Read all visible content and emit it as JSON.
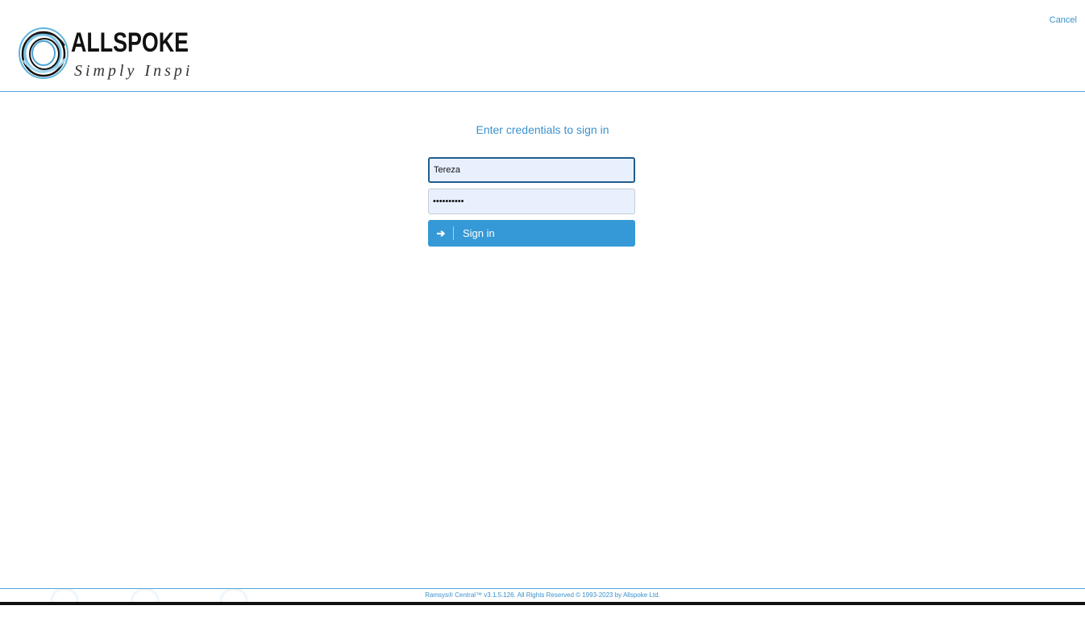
{
  "header": {
    "logo": {
      "brand": "ALLSPOKE",
      "tagline": "Simply Inspired"
    },
    "cancel_label": "Cancel"
  },
  "form": {
    "title": "Enter credentials to sign in",
    "username_value": "Tereza",
    "password_value": "••••••••••",
    "signin_label": "Sign in",
    "signin_icon": "arrow-right-icon"
  },
  "footer": {
    "text": "Ramsys® Central™ v3.1.5.126. All Rights Reserved © 1993-2023 by Allspoke Ltd."
  },
  "colors": {
    "accent": "#3a92cc",
    "button": "#3499d6",
    "input_bg": "#e8f0fe",
    "focus_border": "#1f5c8f"
  }
}
